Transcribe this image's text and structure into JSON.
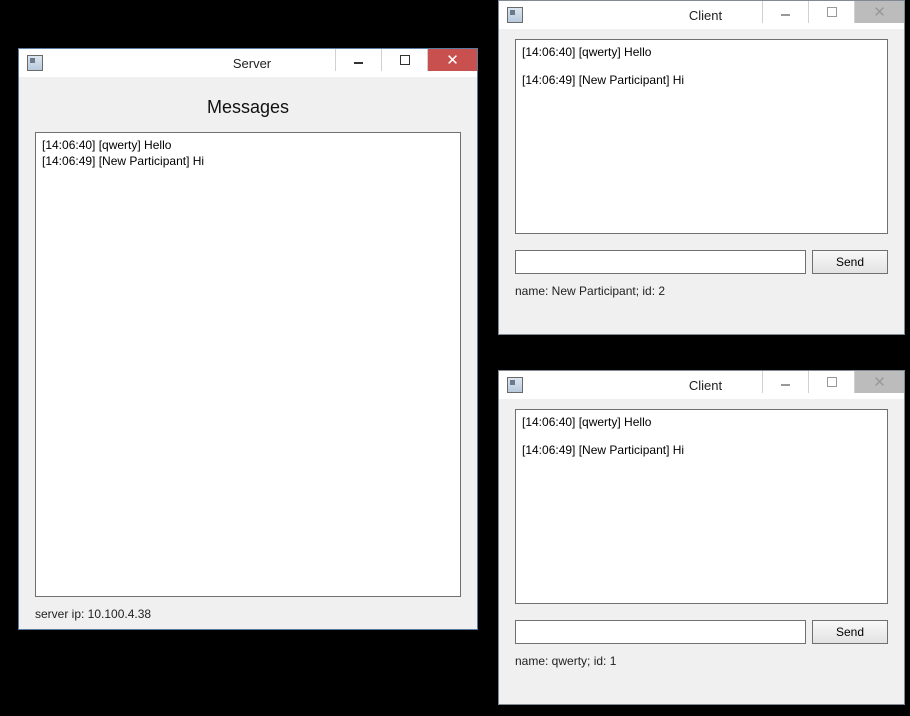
{
  "server": {
    "title": "Server",
    "heading": "Messages",
    "messages": [
      "[14:06:40] [qwerty] Hello",
      "[14:06:49] [New Participant] Hi"
    ],
    "status": "server ip: 10.100.4.38"
  },
  "client1": {
    "title": "Client",
    "messages": [
      "[14:06:40] [qwerty] Hello",
      "[14:06:49] [New Participant] Hi"
    ],
    "input_value": "",
    "send_label": "Send",
    "status": "name: New Participant; id: 2"
  },
  "client2": {
    "title": "Client",
    "messages": [
      "[14:06:40] [qwerty] Hello",
      "[14:06:49] [New Participant] Hi"
    ],
    "input_value": "",
    "send_label": "Send",
    "status": "name: qwerty; id: 1"
  }
}
